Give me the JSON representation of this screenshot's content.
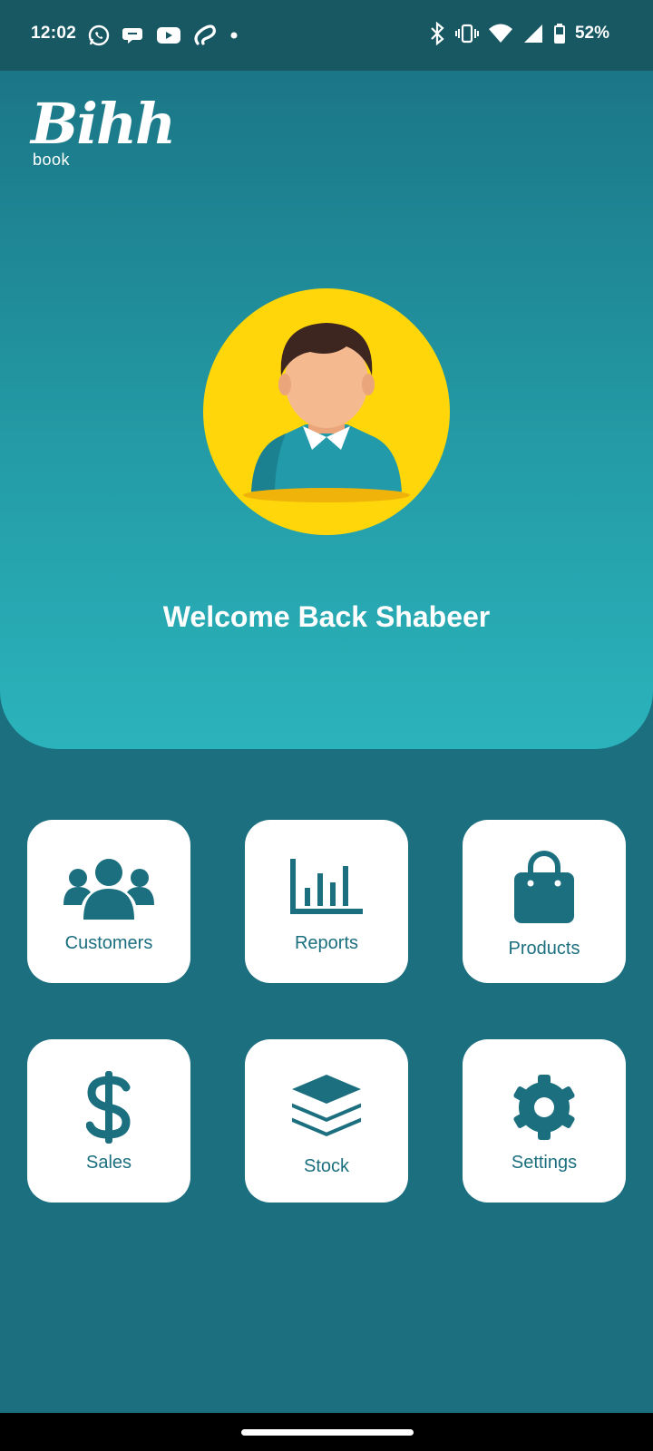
{
  "status_bar": {
    "time": "12:02",
    "left_icons": [
      "whatsapp-icon",
      "messages-icon",
      "youtube-icon",
      "airtel-icon",
      "dot-icon"
    ],
    "right_icons": [
      "bluetooth-icon",
      "vibrate-icon",
      "wifi-icon",
      "signal-icon",
      "battery-icon"
    ],
    "battery": "52%"
  },
  "app": {
    "logo_script": "Bihh",
    "logo_sub": "book",
    "welcome": "Welcome Back Shabeer",
    "accent": "#1b6f7f",
    "avatar_bg": "#ffd60a"
  },
  "tiles": [
    {
      "label": "Customers",
      "icon": "customers-icon"
    },
    {
      "label": "Reports",
      "icon": "reports-icon"
    },
    {
      "label": "Products",
      "icon": "shopping-bag-icon"
    },
    {
      "label": "Sales",
      "icon": "dollar-icon"
    },
    {
      "label": "Stock",
      "icon": "layers-icon"
    },
    {
      "label": "Settings",
      "icon": "gear-icon"
    }
  ]
}
